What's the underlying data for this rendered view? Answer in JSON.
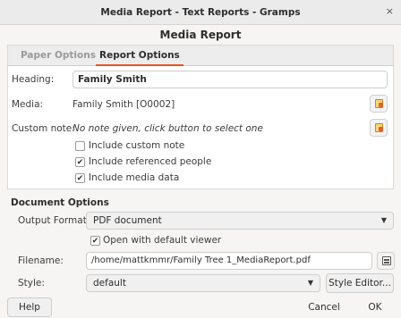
{
  "window": {
    "title": "Media Report - Text Reports - Gramps",
    "close_glyph": "×"
  },
  "dialog_heading": "Media Report",
  "tabs": [
    {
      "label": "Paper Options",
      "active": false
    },
    {
      "label": "Report Options",
      "active": true
    }
  ],
  "report_options": {
    "heading_label": "Heading:",
    "heading_value": "Family Smith",
    "media_label": "Media:",
    "media_value": "Family Smith [O0002]",
    "custom_note_label": "Custom note:",
    "custom_note_value": "No note given, click button to select one",
    "include_custom_note": {
      "label": "Include custom note",
      "checked": false
    },
    "include_referenced_people": {
      "label": "Include referenced people",
      "checked": true
    },
    "include_media_data": {
      "label": "Include media data",
      "checked": true
    }
  },
  "document_options": {
    "section_title": "Document Options",
    "output_format_label": "Output Format:",
    "output_format_value": "PDF document",
    "open_with_default_viewer": {
      "label": "Open with default viewer",
      "checked": true
    },
    "filename_label": "Filename:",
    "filename_value": "/home/mattkmmr/Family Tree 1_MediaReport.pdf",
    "style_label": "Style:",
    "style_value": "default",
    "style_editor_label": "Style Editor..."
  },
  "footer": {
    "help_label": "Help",
    "cancel_label": "Cancel",
    "ok_label": "OK"
  },
  "colors": {
    "accent": "#e95420",
    "background": "#f6f5f4",
    "panel": "#ffffff"
  }
}
